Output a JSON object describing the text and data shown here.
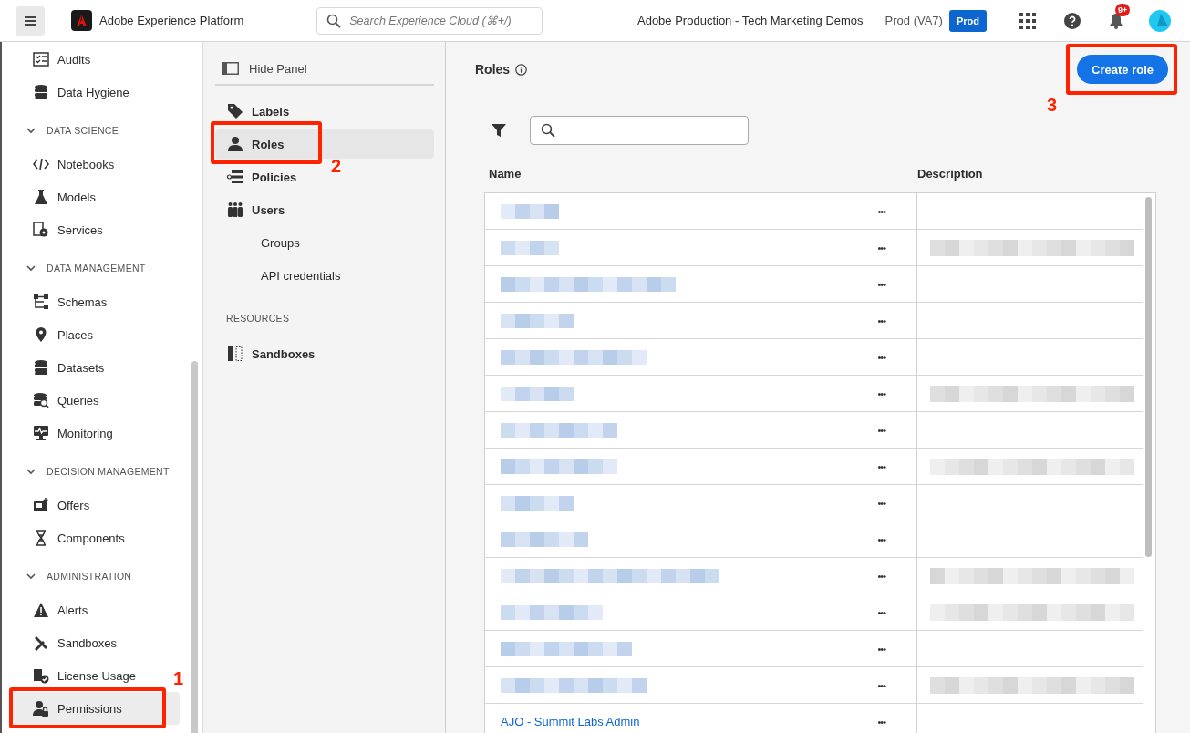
{
  "topbar": {
    "app_name": "Adobe Experience Platform",
    "search": {
      "placeholder": "Search Experience Cloud (⌘+/)"
    },
    "org": "Adobe Production - Tech Marketing Demos",
    "sandbox": "Prod (VA7)",
    "env_badge": "Prod",
    "notifications": "9+"
  },
  "sidebar": {
    "items": [
      {
        "kind": "item",
        "label": "Audits",
        "selected": false
      },
      {
        "kind": "item",
        "label": "Data Hygiene",
        "selected": false
      },
      {
        "kind": "section",
        "label": "DATA SCIENCE",
        "expanded": true
      },
      {
        "kind": "item",
        "label": "Notebooks",
        "selected": false
      },
      {
        "kind": "item",
        "label": "Models",
        "selected": false
      },
      {
        "kind": "item",
        "label": "Services",
        "selected": false
      },
      {
        "kind": "section",
        "label": "DATA MANAGEMENT",
        "expanded": true
      },
      {
        "kind": "item",
        "label": "Schemas",
        "selected": false
      },
      {
        "kind": "item",
        "label": "Places",
        "selected": false
      },
      {
        "kind": "item",
        "label": "Datasets",
        "selected": false
      },
      {
        "kind": "item",
        "label": "Queries",
        "selected": false
      },
      {
        "kind": "item",
        "label": "Monitoring",
        "selected": false
      },
      {
        "kind": "section",
        "label": "DECISION MANAGEMENT",
        "expanded": true
      },
      {
        "kind": "item",
        "label": "Offers",
        "selected": false
      },
      {
        "kind": "item",
        "label": "Components",
        "selected": false
      },
      {
        "kind": "section",
        "label": "ADMINISTRATION",
        "expanded": true
      },
      {
        "kind": "item",
        "label": "Alerts",
        "selected": false
      },
      {
        "kind": "item",
        "label": "Sandboxes",
        "selected": false
      },
      {
        "kind": "item",
        "label": "License Usage",
        "selected": false
      },
      {
        "kind": "item",
        "label": "Permissions",
        "selected": true,
        "callout": "1"
      }
    ]
  },
  "panel": {
    "hide_label": "Hide Panel",
    "items": [
      {
        "kind": "item",
        "label": "Labels",
        "selected": false
      },
      {
        "kind": "item",
        "label": "Roles",
        "selected": true,
        "callout": "2"
      },
      {
        "kind": "item",
        "label": "Policies",
        "selected": false
      },
      {
        "kind": "item",
        "label": "Users",
        "selected": false
      },
      {
        "kind": "sub",
        "label": "Groups",
        "selected": false
      },
      {
        "kind": "sub",
        "label": "API credentials",
        "selected": false
      },
      {
        "kind": "section",
        "label": "RESOURCES"
      },
      {
        "kind": "item",
        "label": "Sandboxes",
        "selected": false
      }
    ]
  },
  "main": {
    "title": "Roles",
    "create_button": {
      "label": "Create role",
      "callout": "3"
    },
    "table": {
      "columns": [
        "Name",
        "Description"
      ],
      "rows": [
        {
          "kind": "redacted",
          "actions": "•••",
          "description_redacted": false
        },
        {
          "kind": "redacted",
          "actions": "•••",
          "description_redacted": true
        },
        {
          "kind": "redacted",
          "actions": "•••",
          "description_redacted": false
        },
        {
          "kind": "redacted",
          "actions": "•••",
          "description_redacted": false
        },
        {
          "kind": "redacted",
          "actions": "•••",
          "description_redacted": false
        },
        {
          "kind": "redacted",
          "actions": "•••",
          "description_redacted": true
        },
        {
          "kind": "redacted",
          "actions": "•••",
          "description_redacted": false
        },
        {
          "kind": "redacted",
          "actions": "•••",
          "description_redacted": true
        },
        {
          "kind": "redacted",
          "actions": "•••",
          "description_redacted": false
        },
        {
          "kind": "redacted",
          "actions": "•••",
          "description_redacted": false
        },
        {
          "kind": "redacted",
          "actions": "•••",
          "description_redacted": true
        },
        {
          "kind": "redacted",
          "actions": "•••",
          "description_redacted": true
        },
        {
          "kind": "redacted",
          "actions": "•••",
          "description_redacted": false
        },
        {
          "kind": "redacted",
          "actions": "•••",
          "description_redacted": true
        },
        {
          "kind": "text",
          "name": "AJO - Summit Labs Admin",
          "actions": "•••",
          "description_redacted": false
        }
      ]
    }
  }
}
